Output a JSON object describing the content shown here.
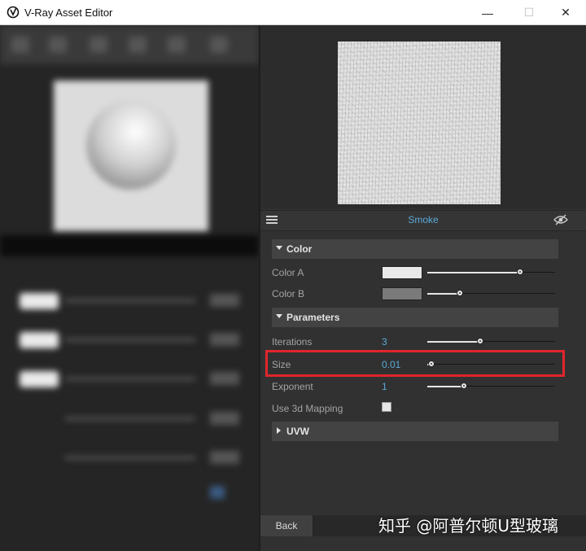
{
  "window": {
    "title": "V-Ray Asset Editor",
    "minimize_glyph": "—",
    "maximize_glyph": "☐",
    "close_glyph": "✕"
  },
  "material": {
    "name": "Smoke"
  },
  "sections": {
    "color": {
      "label": "Color"
    },
    "parameters": {
      "label": "Parameters"
    },
    "uvw": {
      "label": "UVW"
    }
  },
  "properties": {
    "color_a": {
      "label": "Color A",
      "swatch": "#e8e8e8",
      "slider": 0.74
    },
    "color_b": {
      "label": "Color B",
      "swatch": "#7a7a7a",
      "slider": 0.24
    },
    "iterations": {
      "label": "Iterations",
      "value": "3",
      "slider": 0.41
    },
    "size": {
      "label": "Size",
      "value": "0.01",
      "slider": 0.0
    },
    "exponent": {
      "label": "Exponent",
      "value": "1",
      "slider": 0.27
    },
    "use_3d_mapping": {
      "label": "Use 3d Mapping",
      "checked": false
    }
  },
  "bottom": {
    "back_label": "Back"
  },
  "watermark": {
    "text": "知乎 @阿普尔顿U型玻璃"
  },
  "colors": {
    "accent": "#5aa9d8",
    "highlight": "#e0252c"
  }
}
